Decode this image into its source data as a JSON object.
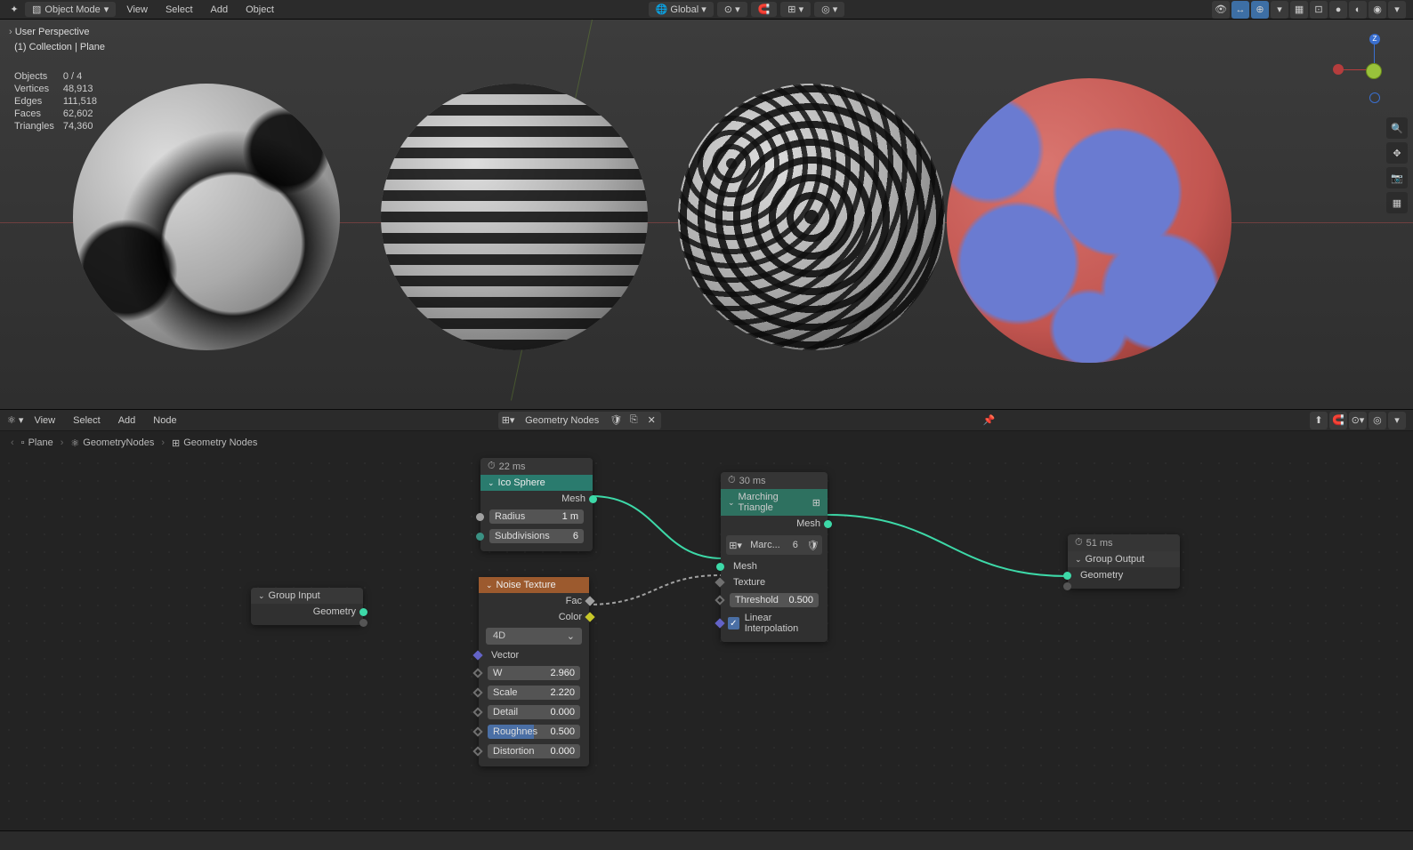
{
  "top_menu": {
    "mode": "Object Mode",
    "items": [
      "View",
      "Select",
      "Add",
      "Object"
    ],
    "orientation": "Global"
  },
  "viewport_overlay": {
    "line1": "User Perspective",
    "line2": "(1) Collection | Plane"
  },
  "stats": [
    {
      "label": "Objects",
      "value": "0 / 4"
    },
    {
      "label": "Vertices",
      "value": "48,913"
    },
    {
      "label": "Edges",
      "value": "111,518"
    },
    {
      "label": "Faces",
      "value": "62,602"
    },
    {
      "label": "Triangles",
      "value": "74,360"
    }
  ],
  "gizmo_z": "Z",
  "node_header": {
    "items": [
      "View",
      "Select",
      "Add",
      "Node"
    ],
    "tree_name": "Geometry Nodes"
  },
  "breadcrumb": {
    "crumbs": [
      "Plane",
      "GeometryNodes",
      "Geometry Nodes"
    ]
  },
  "nodes": {
    "group_input": {
      "title": "Group Input",
      "out_geometry": "Geometry"
    },
    "ico_sphere": {
      "timing": "22 ms",
      "title": "Ico Sphere",
      "out_mesh": "Mesh",
      "radius_label": "Radius",
      "radius_value": "1 m",
      "subdiv_label": "Subdivisions",
      "subdiv_value": "6"
    },
    "noise_texture": {
      "title": "Noise Texture",
      "out_fac": "Fac",
      "out_color": "Color",
      "dimensions": "4D",
      "in_vector": "Vector",
      "w_label": "W",
      "w_value": "2.960",
      "scale_label": "Scale",
      "scale_value": "2.220",
      "detail_label": "Detail",
      "detail_value": "0.000",
      "roughness_label": "Roughnes",
      "roughness_value": "0.500",
      "distortion_label": "Distortion",
      "distortion_value": "0.000"
    },
    "marching": {
      "timing": "30 ms",
      "title": "Marching Triangle",
      "out_mesh": "Mesh",
      "group_name": "Marc...",
      "group_users": "6",
      "in_mesh": "Mesh",
      "in_texture": "Texture",
      "threshold_label": "Threshold",
      "threshold_value": "0.500",
      "linear_label": "Linear Interpolation"
    },
    "group_output": {
      "timing": "51 ms",
      "title": "Group Output",
      "in_geometry": "Geometry"
    }
  }
}
